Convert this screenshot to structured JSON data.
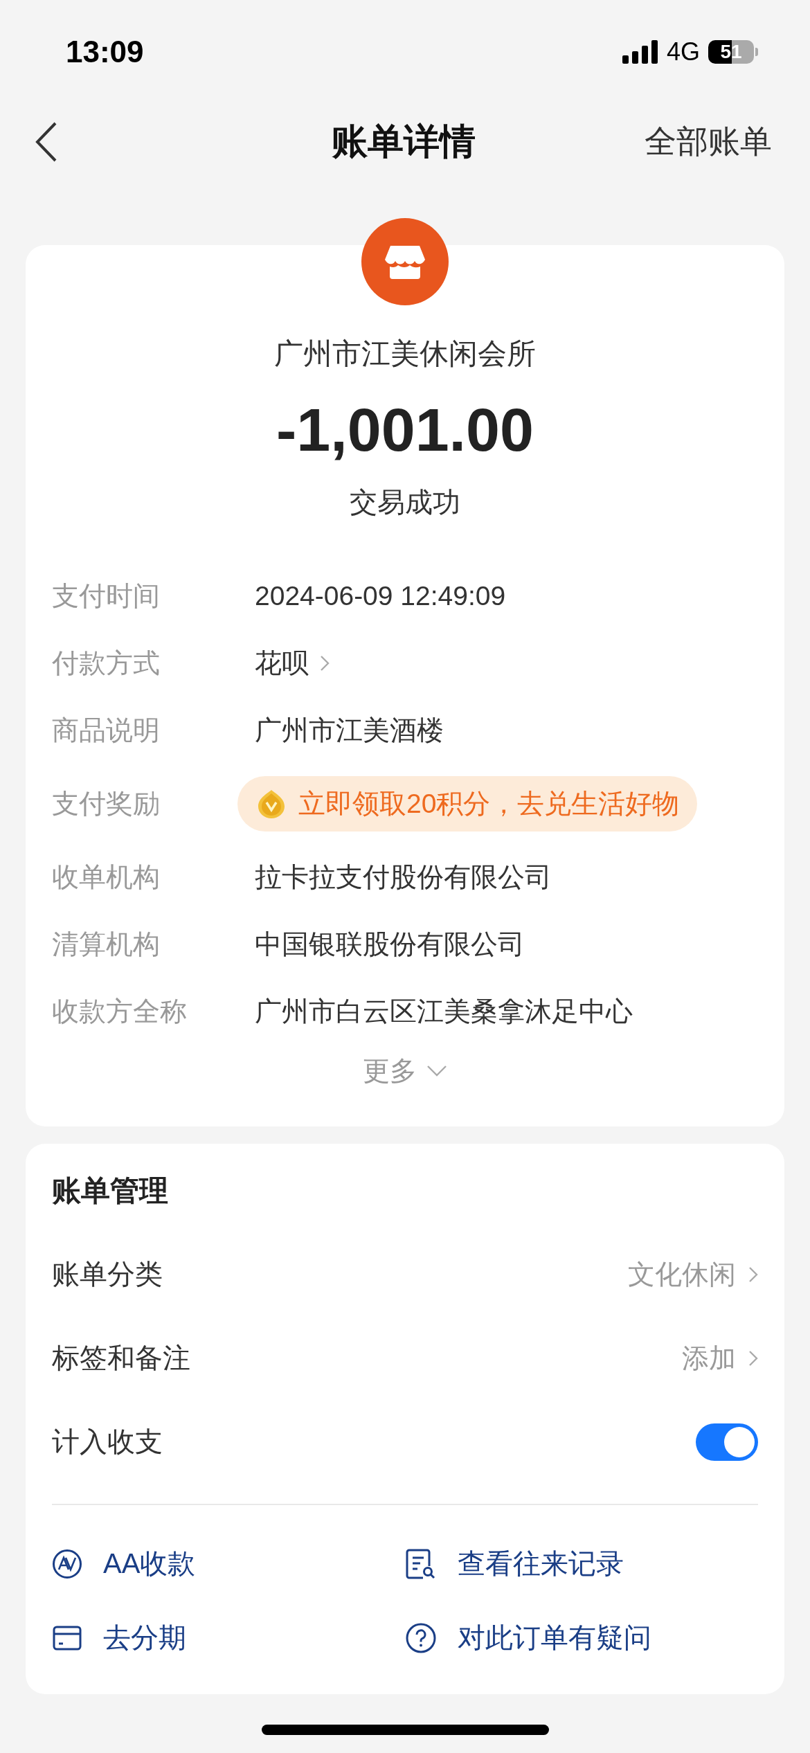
{
  "status_bar": {
    "time": "13:09",
    "network": "4G",
    "battery": "51"
  },
  "nav": {
    "title": "账单详情",
    "action": "全部账单"
  },
  "merchant": {
    "name": "广州市江美休闲会所",
    "amount": "-1,001.00",
    "status": "交易成功"
  },
  "details": [
    {
      "kind": "text",
      "label": "支付时间",
      "value": "2024-06-09 12:49:09"
    },
    {
      "kind": "link",
      "label": "付款方式",
      "value": "花呗"
    },
    {
      "kind": "text",
      "label": "商品说明",
      "value": "广州市江美酒楼"
    },
    {
      "kind": "reward",
      "label": "支付奖励",
      "value": "立即领取20积分，去兑生活好物"
    },
    {
      "kind": "text",
      "label": "收单机构",
      "value": "拉卡拉支付股份有限公司"
    },
    {
      "kind": "text",
      "label": "清算机构",
      "value": "中国银联股份有限公司"
    },
    {
      "kind": "text",
      "label": "收款方全称",
      "value": "广州市白云区江美桑拿沐足中心"
    }
  ],
  "more": "更多",
  "management": {
    "title": "账单管理",
    "rows": [
      {
        "kind": "link",
        "label": "账单分类",
        "value": "文化休闲"
      },
      {
        "kind": "link",
        "label": "标签和备注",
        "value": "添加"
      },
      {
        "kind": "toggle",
        "label": "计入收支",
        "on": true
      }
    ]
  },
  "actions": [
    {
      "kind": "aa",
      "label": "AA收款"
    },
    {
      "kind": "records",
      "label": "查看往来记录"
    },
    {
      "kind": "installment",
      "label": "去分期"
    },
    {
      "kind": "question",
      "label": "对此订单有疑问"
    }
  ]
}
